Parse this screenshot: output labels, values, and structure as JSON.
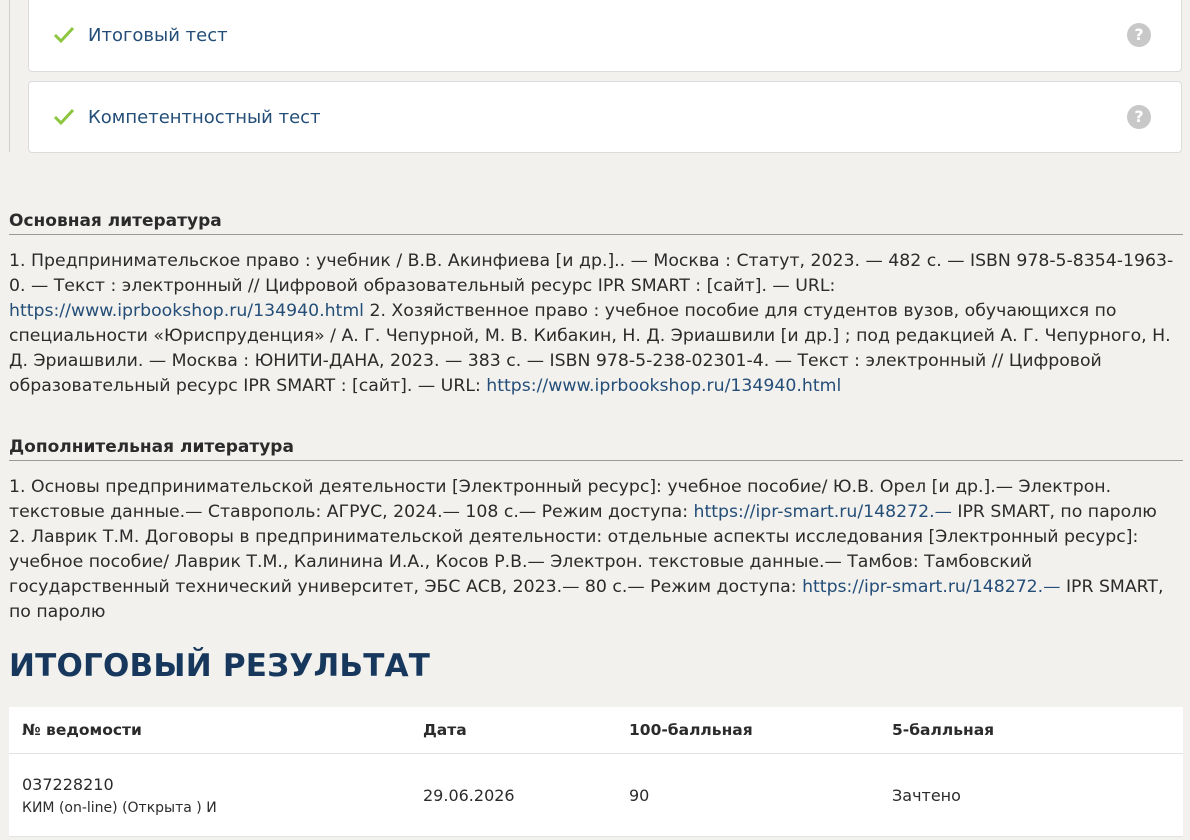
{
  "tests": [
    {
      "label": "Итоговый тест",
      "help": "?"
    },
    {
      "label": "Компетентностный тест",
      "help": "?"
    }
  ],
  "main_literature": {
    "title": "Основная литература",
    "p1": "1. Предпринимательское право : учебник / В.В. Акинфиева [и др.].. — Москва : Статут, 2023. — 482 с. — ISBN 978-5-8354-1963-0. — Текст : электронный // Цифровой образовательный ресурс IPR SMART : [сайт]. — URL: ",
    "link1": "https://www.iprbookshop.ru/134940.html",
    "p2": " 2. Хозяйственное право : учебное пособие для студентов вузов, обучающихся по специальности «Юриспруденция» / А. Г. Чепурной, М. В. Кибакин, Н. Д. Эриашвили [и др.] ; под редакцией А. Г. Чепурного, Н. Д. Эриашвили. — Москва : ЮНИТИ-ДАНА, 2023. — 383 с. — ISBN 978-5-238-02301-4. — Текст : электронный // Цифровой образовательный ресурс IPR SMART : [сайт]. — URL: ",
    "link2": "https://www.iprbookshop.ru/134940.html"
  },
  "extra_literature": {
    "title": "Дополнительная литература",
    "p1": "1. Основы предпринимательской деятельности [Электронный ресурс]: учебное пособие/ Ю.В. Орел [и др.].— Электрон. текстовые данные.— Ставрополь: АГРУС, 2024.— 108 с.— Режим доступа: ",
    "link1": "https://ipr-smart.ru/148272.—",
    "p2": " IPR SMART, по паролю",
    "p3": "2. Лаврик Т.М. Договоры в предпринимательской деятельности: отдельные аспекты исследования [Электронный ресурс]: учебное пособие/ Лаврик Т.М., Калинина И.А., Косов Р.В.— Электрон. текстовые данные.— Тамбов: Тамбовский государственный технический университет, ЭБС АСВ, 2023.— 80 с.— Режим доступа: ",
    "link2": "https://ipr-smart.ru/148272.—",
    "p4": " IPR SMART, по паролю"
  },
  "result": {
    "heading": "ИТОГОВЫЙ РЕЗУЛЬТАТ",
    "columns": [
      "№ ведомости",
      "Дата",
      "100-балльная",
      "5-балльная"
    ],
    "rows": [
      {
        "number": "037228210",
        "type": "КИМ (on-line) (Открыта ) И",
        "date": "29.06.2026",
        "score100": "90",
        "score5": "Зачтено"
      }
    ]
  },
  "colors": {
    "accent": "#244e78",
    "heading": "#17385c",
    "check": "#8cc63f"
  }
}
